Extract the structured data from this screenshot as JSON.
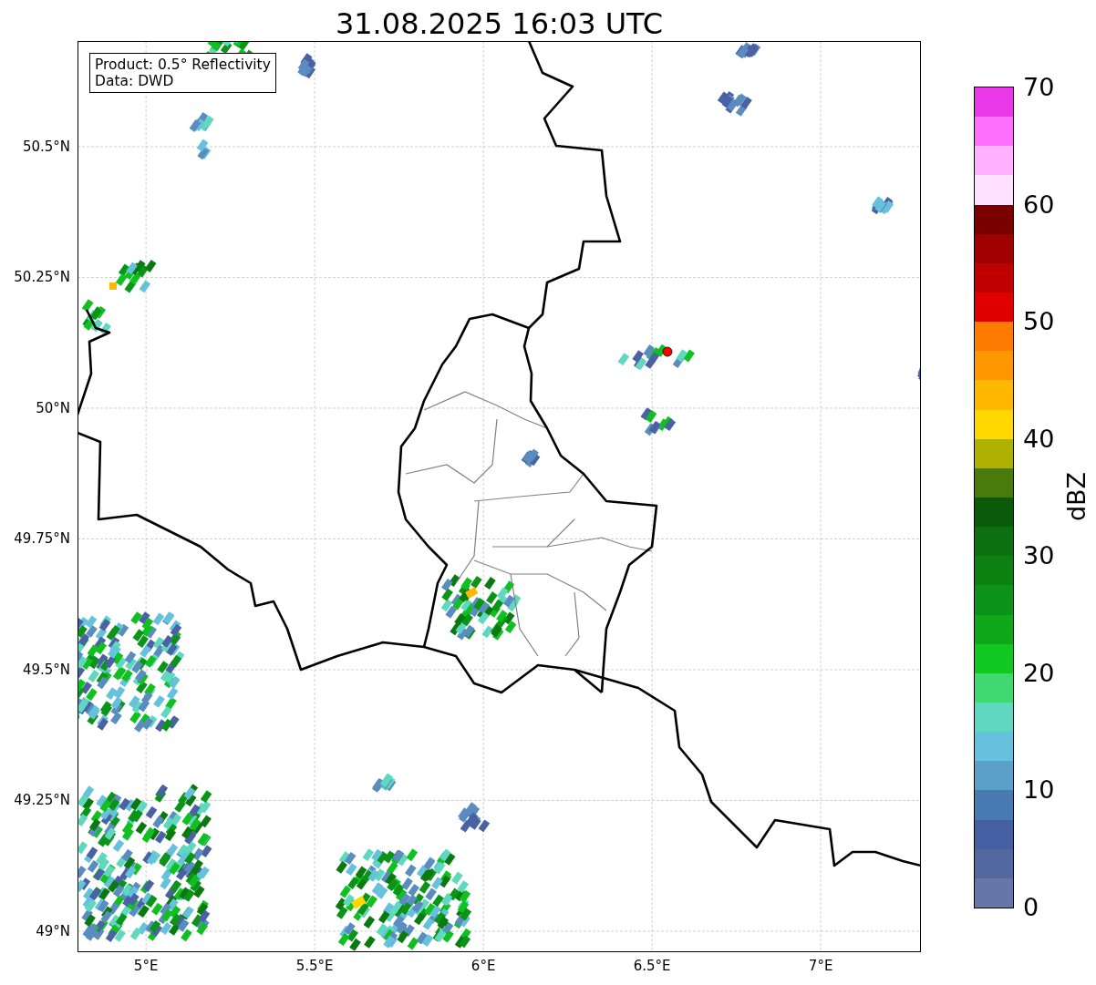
{
  "title": "31.08.2025 16:03 UTC",
  "info_box": {
    "lines": [
      "Product: 0.5° Reflectivity",
      "Data: DWD"
    ]
  },
  "map": {
    "lat_ticks": [
      "50.5°N",
      "50.25°N",
      "50°N",
      "49.75°N",
      "49.5°N",
      "49.25°N",
      "49°N"
    ],
    "lon_ticks": [
      "5°E",
      "5.5°E",
      "6°E",
      "6.5°E",
      "7°E"
    ]
  },
  "colorbar": {
    "label": "dBZ",
    "ticks": [
      "70",
      "60",
      "50",
      "40",
      "30",
      "20",
      "10",
      "0"
    ],
    "bands": [
      {
        "color": "#e838e8"
      },
      {
        "color": "#ff70ff"
      },
      {
        "color": "#ffb0ff"
      },
      {
        "color": "#ffe0ff"
      },
      {
        "color": "#7a0000"
      },
      {
        "color": "#a00000"
      },
      {
        "color": "#c00000"
      },
      {
        "color": "#e00000"
      },
      {
        "color": "#ff7a00"
      },
      {
        "color": "#ff9800"
      },
      {
        "color": "#ffb800"
      },
      {
        "color": "#ffd800"
      },
      {
        "color": "#b0b000"
      },
      {
        "color": "#4a7a0a"
      },
      {
        "color": "#0a5a0a"
      },
      {
        "color": "#0c7010"
      },
      {
        "color": "#0c8010"
      },
      {
        "color": "#0c9418"
      },
      {
        "color": "#10a818"
      },
      {
        "color": "#10c820"
      },
      {
        "color": "#40d870"
      },
      {
        "color": "#60d8c0"
      },
      {
        "color": "#66c2dc"
      },
      {
        "color": "#5aa0c8"
      },
      {
        "color": "#4a7ab2"
      },
      {
        "color": "#4560a2"
      },
      {
        "color": "#5468a0"
      },
      {
        "color": "#6676a8"
      }
    ]
  }
}
